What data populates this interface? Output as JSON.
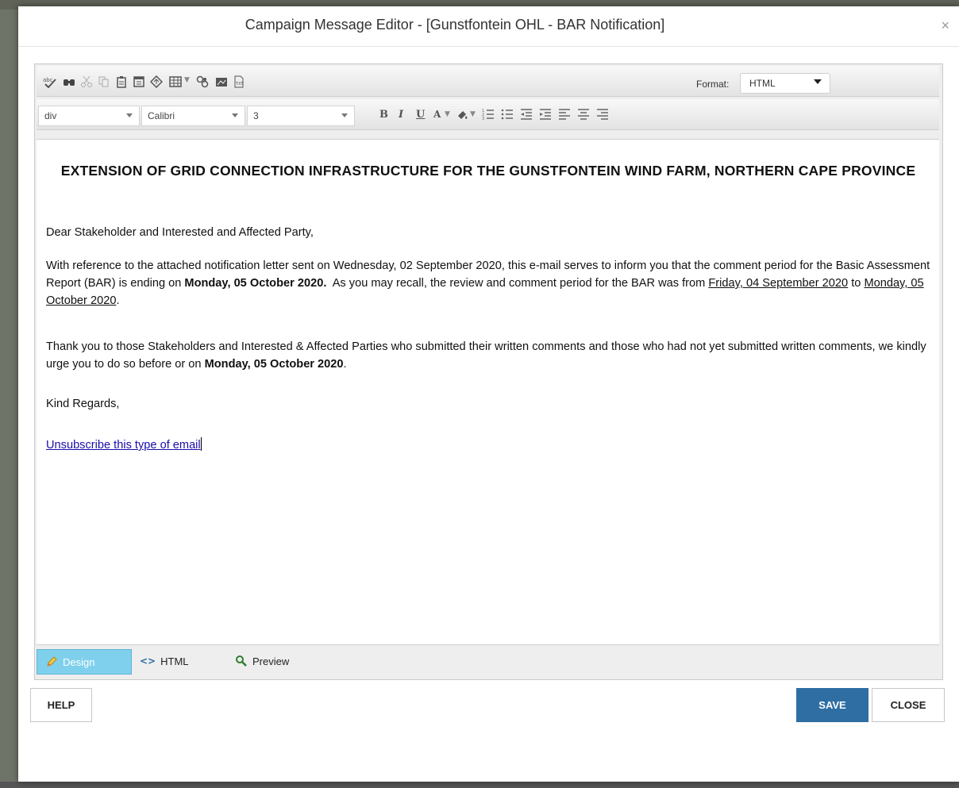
{
  "dialog": {
    "title": "Campaign Message Editor - [Gunstfontein OHL - BAR Notification]",
    "close_glyph": "×"
  },
  "toolbar": {
    "format_label": "Format:",
    "format_value": "HTML",
    "icons_row1": [
      "spellcheck-icon",
      "find-icon",
      "cut-icon",
      "copy-icon",
      "paste-icon",
      "paste-word-icon",
      "link-icon",
      "table-icon",
      "image-manager-icon",
      "media-icon",
      "document-icon"
    ],
    "paragraph_value": "div",
    "font_value": "Calibri",
    "size_value": "3",
    "icons_row2": [
      "bold-icon",
      "italic-icon",
      "underline-icon",
      "font-color-icon",
      "highlight-icon",
      "numbered-list-icon",
      "bulleted-list-icon",
      "outdent-icon",
      "indent-icon",
      "align-left-icon",
      "align-center-icon",
      "align-right-icon"
    ]
  },
  "content": {
    "heading": "EXTENSION OF GRID CONNECTION INFRASTRUCTURE FOR THE GUNSTFONTEIN WIND FARM, NORTHERN CAPE PROVINCE",
    "salutation": "Dear Stakeholder and Interested and Affected Party,",
    "p2_a": "With reference to the attached notification letter sent on Wednesday, 02 September 2020, this e-mail serves to inform you that the comment period for the Basic Assessment Report (BAR) is ending on ",
    "p2_bold": "Monday, 05 October 2020.",
    "p2_b": "  As you may recall, the review and comment period for the BAR was from ",
    "p2_u1": "Friday, 04 September 2020",
    "p2_c": " to ",
    "p2_u2": "Monday, 05 October 2020",
    "p2_d": ".",
    "p3_a": "Thank you to those Stakeholders and Interested & Affected Parties who submitted their written comments and those who had not yet submitted written comments, we kindly urge you to do so before or on ",
    "p3_bold": "Monday, 05 October 2020",
    "p3_b": ".",
    "closing": "Kind Regards,",
    "unsubscribe": "Unsubscribe this type of email"
  },
  "modes": {
    "design": "Design",
    "html": "HTML",
    "preview": "Preview",
    "active": "Design"
  },
  "buttons": {
    "help": "HELP",
    "save": "SAVE",
    "close": "CLOSE"
  },
  "colors": {
    "save_bg": "#2f6ea3",
    "design_tab_bg": "#7fd0ec",
    "link": "#1a0dab"
  }
}
